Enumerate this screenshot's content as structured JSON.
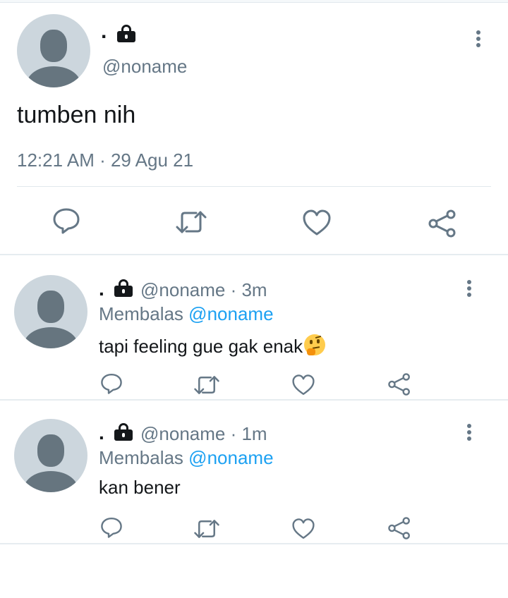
{
  "main_tweet": {
    "name": ".",
    "handle": "@noname",
    "text": "tumben nih",
    "timestamp": "12:21 AM · 29 Agu 21",
    "icons": [
      "protected-lock-icon",
      "more-options-icon",
      "reply-icon",
      "retweet-icon",
      "like-icon",
      "share-icon"
    ]
  },
  "replies": [
    {
      "name": ".",
      "handle_time": "@noname · 3m",
      "replying_prefix": "Membalas",
      "replying_to": "@noname",
      "text": "tapi feeling gue gak enak",
      "emoji": "thinking-face-emoji"
    },
    {
      "name": ".",
      "handle_time": "@noname · 1m",
      "replying_prefix": "Membalas",
      "replying_to": "@noname",
      "text": "kan bener"
    }
  ],
  "colors": {
    "text": "#14171a",
    "secondary": "#657786",
    "link": "#1da1f2",
    "avatar_bg": "#ccd6dd",
    "divider": "#e6ecf0"
  }
}
